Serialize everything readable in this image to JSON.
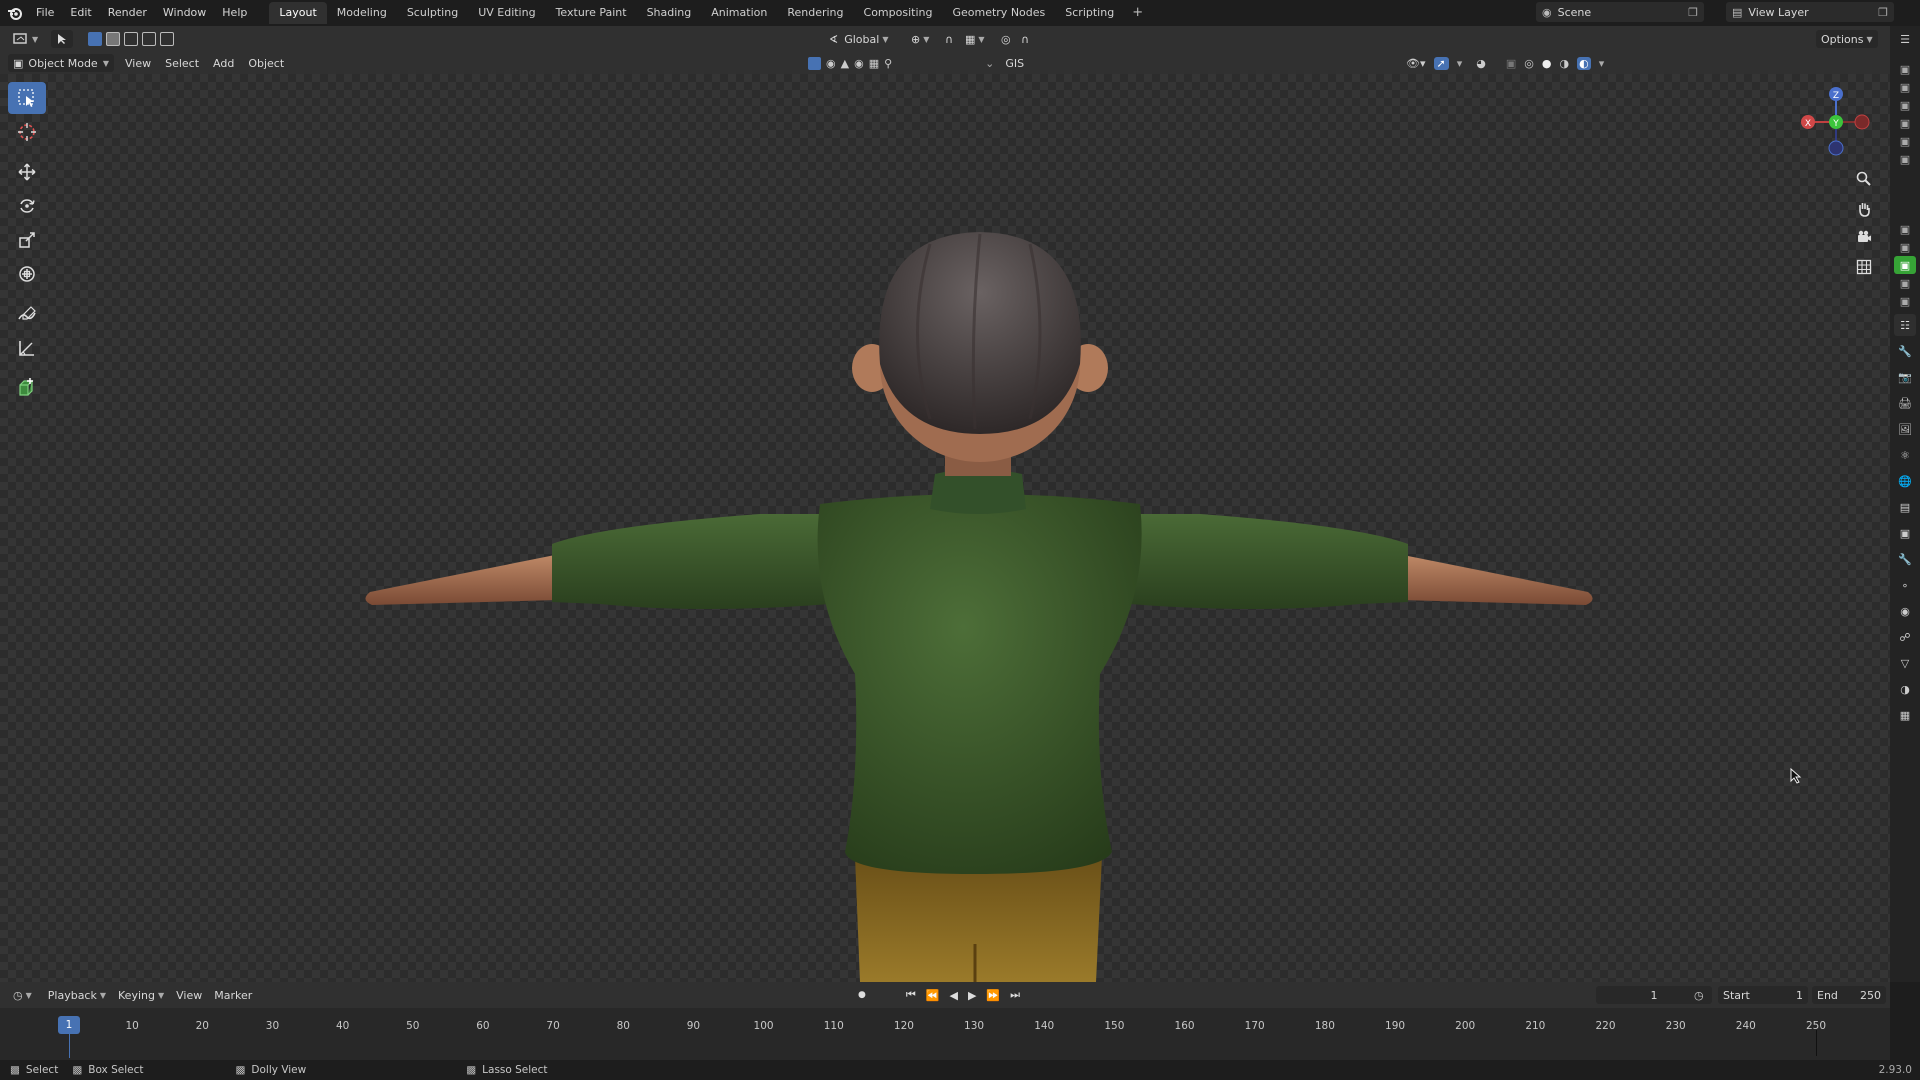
{
  "app": {
    "menu": [
      "File",
      "Edit",
      "Render",
      "Window",
      "Help"
    ],
    "workspaces": [
      "Layout",
      "Modeling",
      "Sculpting",
      "UV Editing",
      "Texture Paint",
      "Shading",
      "Animation",
      "Rendering",
      "Compositing",
      "Geometry Nodes",
      "Scripting"
    ],
    "active_workspace": "Layout",
    "add_workspace": "+",
    "scene": "Scene",
    "view_layer": "View Layer"
  },
  "header": {
    "transform_orientation": "Global",
    "options": "Options",
    "mode": "Object Mode",
    "view": "View",
    "select": "Select",
    "add": "Add",
    "object": "Object",
    "gis": "GIS"
  },
  "tools": [
    "select-box",
    "cursor",
    "move",
    "rotate",
    "scale",
    "transform",
    "annotate",
    "measure",
    "add-cube"
  ],
  "timeline": {
    "playback": "Playback",
    "keying": "Keying",
    "view": "View",
    "marker": "Marker",
    "current_frame": "1",
    "start_label": "Start",
    "start": "1",
    "end_label": "End",
    "end": "250",
    "ticks": [
      "10",
      "20",
      "30",
      "40",
      "50",
      "60",
      "70",
      "80",
      "90",
      "100",
      "110",
      "120",
      "130",
      "140",
      "150",
      "160",
      "170",
      "180",
      "190",
      "200",
      "210",
      "220",
      "230",
      "240",
      "250"
    ],
    "marker_frame": "1"
  },
  "statusbar": {
    "select": "Select",
    "box_select": "Box Select",
    "dolly_view": "Dolly View",
    "lasso_select": "Lasso Select",
    "version": "2.93.0"
  },
  "gizmo": {
    "z": "Z",
    "x": "X",
    "y": "Y"
  },
  "colors": {
    "accent": "#4772b3",
    "shirt": "#3c5a2e",
    "pants": "#8a6a24",
    "skin": "#b07a5a",
    "hair": "#5a5050"
  }
}
